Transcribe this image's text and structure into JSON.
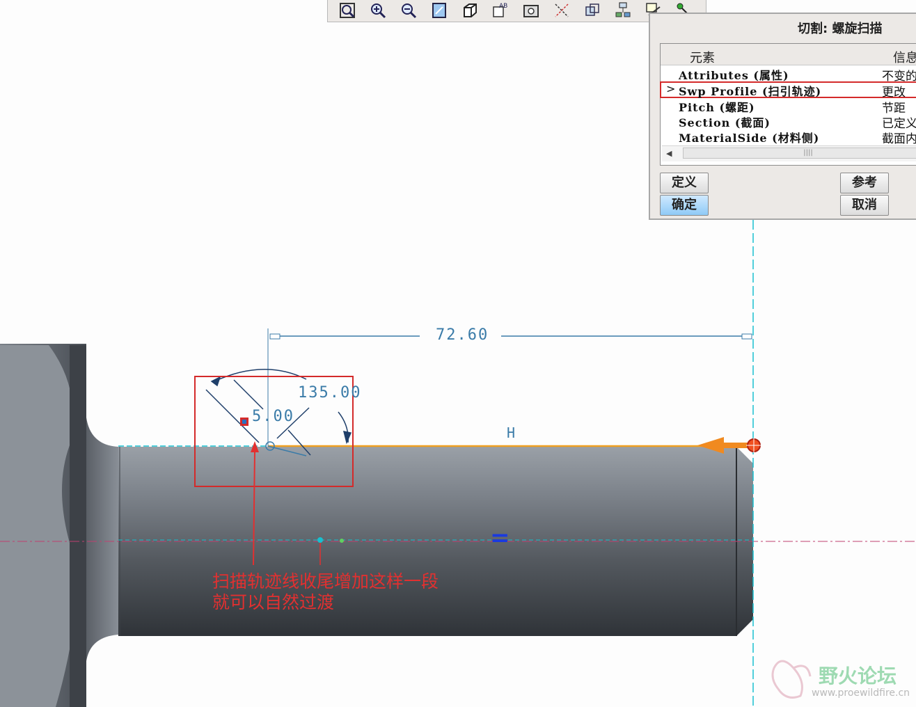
{
  "toolbar": {
    "icons": [
      "zoom-window-icon",
      "zoom-in-icon",
      "zoom-out-icon",
      "repaint-icon",
      "view-orient-icon",
      "annotation-icon",
      "saved-view-icon",
      "datum-axes-icon",
      "refit-icon",
      "model-tree-icon",
      "sketch-icon",
      "feature-icon"
    ]
  },
  "dialog": {
    "title": "切割: 螺旋扫描",
    "col_element": "元素",
    "col_info": "信息",
    "rows": [
      {
        "name": "Attributes (属性)",
        "info": "不变的"
      },
      {
        "name": "Swp Profile (扫引轨迹)",
        "info": "更改"
      },
      {
        "name": "Pitch (螺距)",
        "info": "节距"
      },
      {
        "name": "Section (截面)",
        "info": "已定义"
      },
      {
        "name": "MaterialSide (材料侧)",
        "info": "截面内"
      }
    ],
    "selected_row_marker": ">",
    "scroll_grip": "||||",
    "buttons": {
      "define": "定义",
      "ok": "确定",
      "refs": "参考",
      "cancel": "取消"
    }
  },
  "drawing": {
    "dim_length": "72.60",
    "dim_angle": "135.00",
    "dim_chamfer": "5.00",
    "constraint_h": "H",
    "constraint_eq": "=",
    "annotation_line1": "扫描轨迹线收尾增加这样一段",
    "annotation_line2": "就可以自然过渡"
  },
  "watermark": {
    "name": "野火论坛",
    "url": "www.proewildfire.cn"
  },
  "colors": {
    "sketch_line": "#f0a020",
    "dimension": "#3a7ba8",
    "annotation": "#e23030",
    "centerline": "#18c0d0",
    "shaft": "#6d727a"
  }
}
